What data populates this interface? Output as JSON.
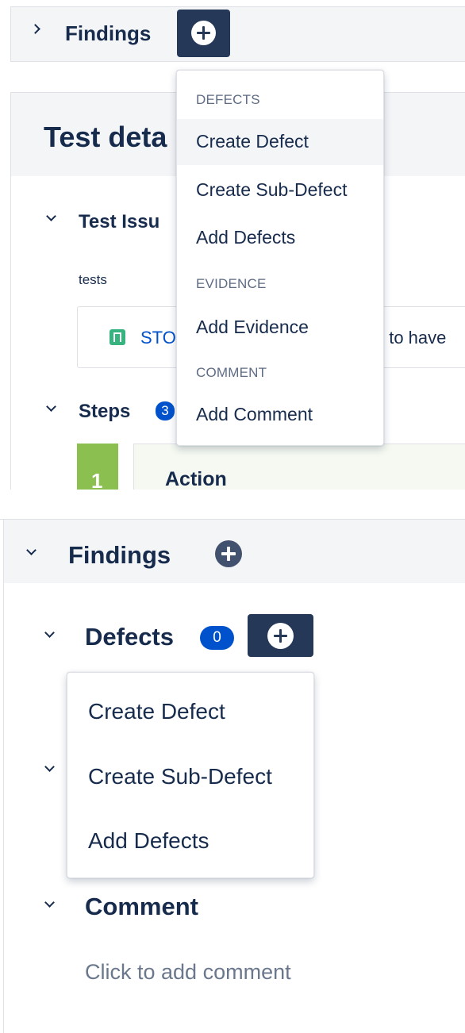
{
  "panel1": {
    "findings_label": "Findings",
    "card_title": "Test deta",
    "test_issue_label": "Test Issu",
    "tests_label": "tests",
    "issue_key_partial": "STO",
    "issue_summary_partial": "t to have",
    "steps_label": "Steps",
    "steps_count": "3",
    "step_number": "1",
    "step_action_label": "Action",
    "menu": {
      "section_defects": "DEFECTS",
      "create_defect": "Create Defect",
      "create_sub_defect": "Create Sub-Defect",
      "add_defects": "Add Defects",
      "section_evidence": "EVIDENCE",
      "add_evidence": "Add Evidence",
      "section_comment": "COMMENT",
      "add_comment": "Add Comment"
    }
  },
  "panel2": {
    "findings_label": "Findings",
    "defects_label": "Defects",
    "defects_count": "0",
    "evidence_count_partial": ")",
    "comment_label": "Comment",
    "comment_placeholder": "Click to add comment",
    "menu": {
      "create_defect": "Create Defect",
      "create_sub_defect": "Create Sub-Defect",
      "add_defects": "Add Defects"
    }
  },
  "colors": {
    "dark_button": "#253858",
    "badge_blue": "#0052cc",
    "step_green": "#8bbf4f",
    "story_green": "#36b37e",
    "header_bg": "#f4f5f7",
    "text_primary": "#172b4d",
    "text_muted": "#6b778c"
  },
  "icons": {
    "collapse_chevron": "chevron-right-icon",
    "expand_chevron": "chevron-down-icon",
    "add": "plus-icon",
    "story": "story-icon"
  }
}
